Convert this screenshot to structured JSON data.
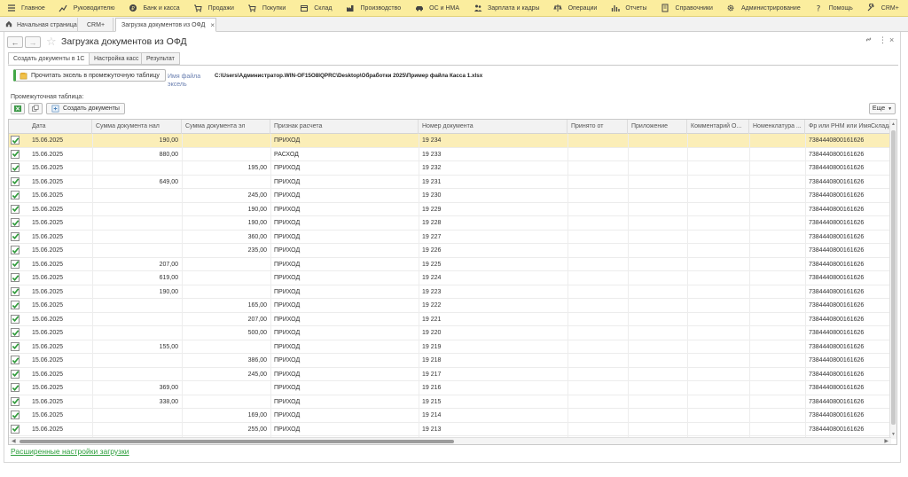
{
  "menu": [
    {
      "label": "Главное",
      "icon": "menu-lines-icon"
    },
    {
      "label": "Руководителю",
      "icon": "chart-icon"
    },
    {
      "label": "Банк и касса",
      "icon": "coin-icon"
    },
    {
      "label": "Продажи",
      "icon": "cart-icon"
    },
    {
      "label": "Покупки",
      "icon": "cart-icon"
    },
    {
      "label": "Склад",
      "icon": "box-icon"
    },
    {
      "label": "Производство",
      "icon": "factory-icon"
    },
    {
      "label": "ОС и НМА",
      "icon": "car-icon"
    },
    {
      "label": "Зарплата и кадры",
      "icon": "people-icon"
    },
    {
      "label": "Операции",
      "icon": "scales-icon"
    },
    {
      "label": "Отчеты",
      "icon": "report-icon"
    },
    {
      "label": "Справочники",
      "icon": "book-icon"
    },
    {
      "label": "Администрирование",
      "icon": "gear-icon"
    },
    {
      "label": "Помощь",
      "icon": "question-icon"
    },
    {
      "label": "CRM+",
      "icon": "wrench-icon"
    }
  ],
  "tabs": {
    "home": "Начальная страница",
    "crm": "CRM+",
    "current": "Загрузка документов из ОФД"
  },
  "form": {
    "title": "Загрузка документов из ОФД",
    "tabs": [
      "Создать документы в 1С",
      "Настройка касс",
      "Результат"
    ],
    "read_button": "Прочитать эксель в промежуточную таблицу",
    "file_label": "Имя файла эксель",
    "file_path": "C:\\Users\\Администратор.WIN-OF15O8IQPRC\\Desktop\\Обработки 2025\\Пример файла Касса 1.xlsx",
    "table_label": "Промежуточная таблица:",
    "create_button": "Создать документы",
    "more_button": "Еще",
    "advanced_link": "Расширенные настройки загрузки"
  },
  "table": {
    "columns": [
      "Дата",
      "Сумма документа нал",
      "Сумма документа эл",
      "Признак расчета",
      "Номер документа",
      "Принято от",
      "Приложение",
      "Комментарий О...",
      "Номенклатура ...",
      "Фр или РНМ или ИмяСклада"
    ],
    "rows": [
      {
        "date": "15.06.2025",
        "cash": "190,00",
        "card": "",
        "type": "ПРИХОД",
        "num": "19 234",
        "fr": "7384440800161626",
        "selected": true
      },
      {
        "date": "15.06.2025",
        "cash": "880,00",
        "card": "",
        "type": "РАСХОД",
        "num": "19 233",
        "fr": "7384440800161626"
      },
      {
        "date": "15.06.2025",
        "cash": "",
        "card": "195,00",
        "type": "ПРИХОД",
        "num": "19 232",
        "fr": "7384440800161626"
      },
      {
        "date": "15.06.2025",
        "cash": "649,00",
        "card": "",
        "type": "ПРИХОД",
        "num": "19 231",
        "fr": "7384440800161626"
      },
      {
        "date": "15.06.2025",
        "cash": "",
        "card": "245,00",
        "type": "ПРИХОД",
        "num": "19 230",
        "fr": "7384440800161626"
      },
      {
        "date": "15.06.2025",
        "cash": "",
        "card": "190,00",
        "type": "ПРИХОД",
        "num": "19 229",
        "fr": "7384440800161626"
      },
      {
        "date": "15.06.2025",
        "cash": "",
        "card": "190,00",
        "type": "ПРИХОД",
        "num": "19 228",
        "fr": "7384440800161626"
      },
      {
        "date": "15.06.2025",
        "cash": "",
        "card": "360,00",
        "type": "ПРИХОД",
        "num": "19 227",
        "fr": "7384440800161626"
      },
      {
        "date": "15.06.2025",
        "cash": "",
        "card": "235,00",
        "type": "ПРИХОД",
        "num": "19 226",
        "fr": "7384440800161626"
      },
      {
        "date": "15.06.2025",
        "cash": "207,00",
        "card": "",
        "type": "ПРИХОД",
        "num": "19 225",
        "fr": "7384440800161626"
      },
      {
        "date": "15.06.2025",
        "cash": "619,00",
        "card": "",
        "type": "ПРИХОД",
        "num": "19 224",
        "fr": "7384440800161626"
      },
      {
        "date": "15.06.2025",
        "cash": "190,00",
        "card": "",
        "type": "ПРИХОД",
        "num": "19 223",
        "fr": "7384440800161626"
      },
      {
        "date": "15.06.2025",
        "cash": "",
        "card": "165,00",
        "type": "ПРИХОД",
        "num": "19 222",
        "fr": "7384440800161626"
      },
      {
        "date": "15.06.2025",
        "cash": "",
        "card": "207,00",
        "type": "ПРИХОД",
        "num": "19 221",
        "fr": "7384440800161626"
      },
      {
        "date": "15.06.2025",
        "cash": "",
        "card": "500,00",
        "type": "ПРИХОД",
        "num": "19 220",
        "fr": "7384440800161626"
      },
      {
        "date": "15.06.2025",
        "cash": "155,00",
        "card": "",
        "type": "ПРИХОД",
        "num": "19 219",
        "fr": "7384440800161626"
      },
      {
        "date": "15.06.2025",
        "cash": "",
        "card": "386,00",
        "type": "ПРИХОД",
        "num": "19 218",
        "fr": "7384440800161626"
      },
      {
        "date": "15.06.2025",
        "cash": "",
        "card": "245,00",
        "type": "ПРИХОД",
        "num": "19 217",
        "fr": "7384440800161626"
      },
      {
        "date": "15.06.2025",
        "cash": "369,00",
        "card": "",
        "type": "ПРИХОД",
        "num": "19 216",
        "fr": "7384440800161626"
      },
      {
        "date": "15.06.2025",
        "cash": "338,00",
        "card": "",
        "type": "ПРИХОД",
        "num": "19 215",
        "fr": "7384440800161626"
      },
      {
        "date": "15.06.2025",
        "cash": "",
        "card": "169,00",
        "type": "ПРИХОД",
        "num": "19 214",
        "fr": "7384440800161626"
      },
      {
        "date": "15.06.2025",
        "cash": "",
        "card": "255,00",
        "type": "ПРИХОД",
        "num": "19 213",
        "fr": "7384440800161626"
      }
    ]
  },
  "colors": {
    "menubar": "#fbed9e",
    "selected_row": "#fbeeb8",
    "accent_green": "#2a9d3a"
  }
}
